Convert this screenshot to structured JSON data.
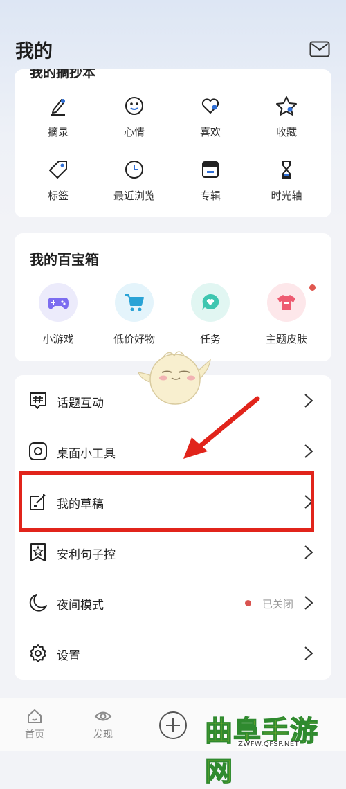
{
  "header": {
    "title": "我的",
    "mail_icon": "mail-icon"
  },
  "clippings": {
    "title_partial": "我的摘抄本",
    "items": [
      {
        "label": "摘录",
        "icon": "pencil-icon"
      },
      {
        "label": "心情",
        "icon": "smile-icon"
      },
      {
        "label": "喜欢",
        "icon": "heart-icon"
      },
      {
        "label": "收藏",
        "icon": "star-icon"
      },
      {
        "label": "标签",
        "icon": "tag-icon"
      },
      {
        "label": "最近浏览",
        "icon": "clock-icon"
      },
      {
        "label": "专辑",
        "icon": "album-icon"
      },
      {
        "label": "时光轴",
        "icon": "hourglass-icon"
      }
    ]
  },
  "toolbox": {
    "title": "我的百宝箱",
    "items": [
      {
        "label": "小游戏",
        "icon": "gamepad-icon"
      },
      {
        "label": "低价好物",
        "icon": "cart-icon"
      },
      {
        "label": "任务",
        "icon": "task-bubble-icon"
      },
      {
        "label": "主题皮肤",
        "icon": "shirt-icon"
      }
    ]
  },
  "menu": {
    "items": [
      {
        "label": "话题互动",
        "icon": "hashtag-icon"
      },
      {
        "label": "桌面小工具",
        "icon": "widget-icon"
      },
      {
        "label": "我的草稿",
        "icon": "draft-icon"
      },
      {
        "label": "安利句子控",
        "icon": "recommend-star-icon"
      },
      {
        "label": "夜间模式",
        "icon": "moon-icon",
        "status": "已关闭"
      },
      {
        "label": "设置",
        "icon": "settings-gear-icon"
      }
    ]
  },
  "tabbar": {
    "items": [
      {
        "label": "首页",
        "icon": "home-icon"
      },
      {
        "label": "发现",
        "icon": "eye-icon"
      }
    ],
    "add_icon": "plus-circle-icon"
  },
  "watermark": {
    "text": "曲阜手游网",
    "url": "ZWFW.QFSP.NET"
  },
  "colors": {
    "highlight": "#e1241b",
    "accent_dot": "#e0574f",
    "icon_blue": "#2f6fd6"
  }
}
